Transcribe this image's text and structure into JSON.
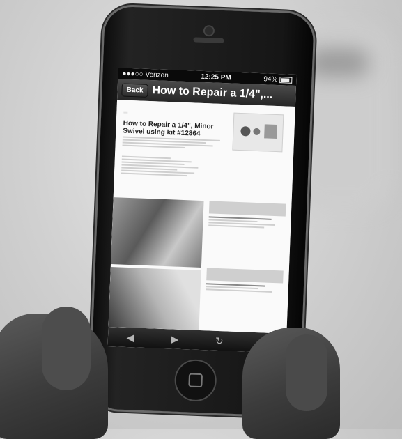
{
  "status_bar": {
    "carrier": "●●●○○ Verizon",
    "wifi_icon": "wifi-icon",
    "time": "12:25 PM",
    "bluetooth_icon": "bluetooth-icon",
    "battery_text": "94%"
  },
  "nav_bar": {
    "back_label": "Back",
    "title": "How to Repair a 1/4\",..."
  },
  "web_page": {
    "heading": "How to Repair a 1/4\", Minor Swivel using kit #12864"
  },
  "toolbar": {
    "icons": [
      "back-arrow-icon",
      "forward-arrow-icon",
      "reload-icon",
      "share-icon"
    ]
  }
}
